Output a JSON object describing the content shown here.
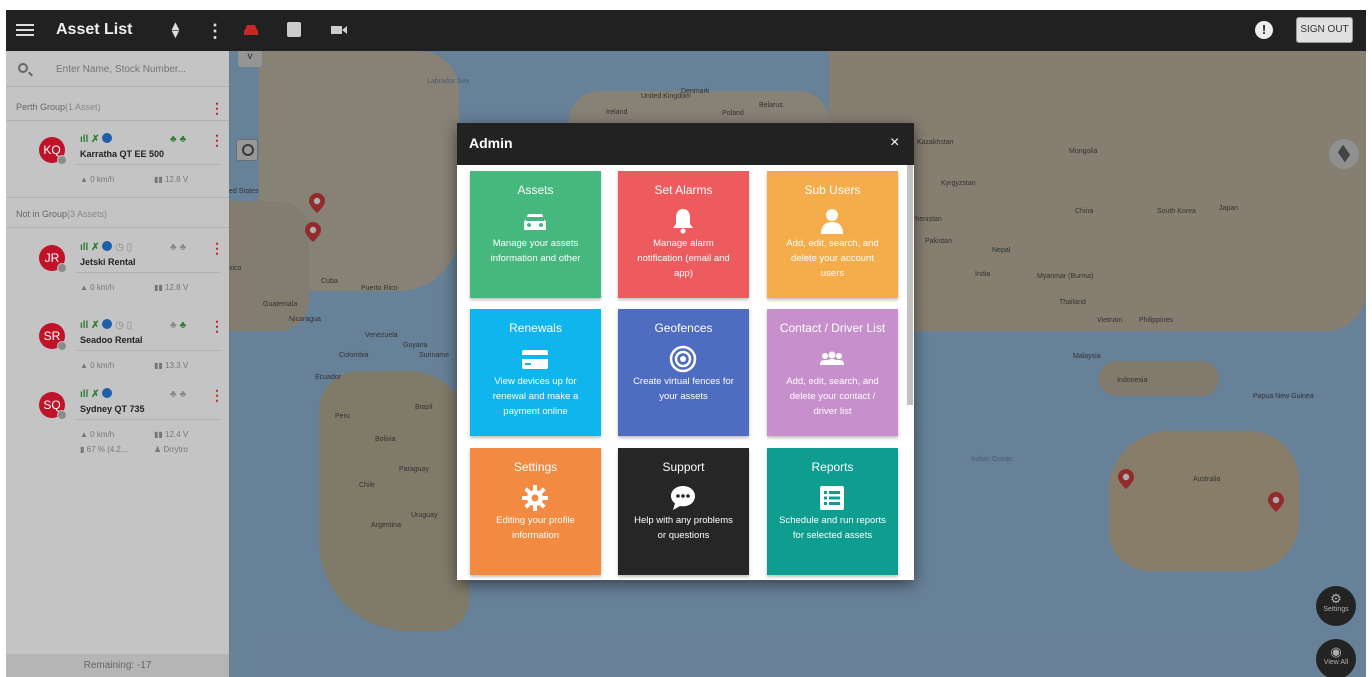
{
  "topbar": {
    "title": "Asset List",
    "sign_out_label": "SIGN OUT",
    "icons": [
      "menu-icon",
      "sort-icon",
      "more-vert-icon",
      "car-icon",
      "map-icon",
      "video-icon",
      "alert-icon"
    ],
    "alert_glyph": "!"
  },
  "sidebar": {
    "search_placeholder": "Enter Name, Stock Number...",
    "groups": [
      {
        "name": "Perth Group",
        "count": "(1 Asset)"
      },
      {
        "name": "Not in Group",
        "count": "(3 Assets)"
      }
    ],
    "assets": [
      {
        "initials": "KQ",
        "name": "Karratha QT EE 500",
        "speed": "0 km/h",
        "voltage": "12.8 V"
      },
      {
        "initials": "JR",
        "name": "Jetski Rental",
        "speed": "0 km/h",
        "voltage": "12.8 V"
      },
      {
        "initials": "SR",
        "name": "Seadoo Rental",
        "speed": "0 km/h",
        "voltage": "13.3 V"
      },
      {
        "initials": "SQ",
        "name": "Sydney QT 735",
        "speed": "0 km/h",
        "voltage": "12.4 V",
        "battery": "67 % (4.2...",
        "driver": "Drrytro"
      }
    ],
    "remaining": "Remaining: -17"
  },
  "map": {
    "labels": [
      "Labrador Sea",
      "United Kingdom",
      "Denmark",
      "Ireland",
      "Poland",
      "Belarus",
      "Kazakhstan",
      "Mongolia",
      "Kyrgyzstan",
      "China",
      "South Korea",
      "Japan",
      "Pakistan",
      "Nepal",
      "India",
      "Myanmar (Burma)",
      "Thailand",
      "Vietnam",
      "Philippines",
      "Malaysia",
      "Indonesia",
      "Papua New Guinea",
      "Australia",
      "Cuba",
      "Puerto Rico",
      "Guatemala",
      "Nicaragua",
      "Venezuela",
      "Guyana",
      "Suriname",
      "Colombia",
      "Ecuador",
      "Peru",
      "Brazil",
      "Bolivia",
      "Paraguay",
      "Chile",
      "Uruguay",
      "Argentina",
      "Indian Ocean",
      "ed States",
      "xico",
      "rhenistan"
    ],
    "controls": {
      "settings_label": "Settings",
      "view_all_label": "View All",
      "zoom_glyph": "v"
    }
  },
  "modal": {
    "title": "Admin",
    "close_glyph": "×",
    "tiles": [
      {
        "title": "Assets",
        "desc": "Manage your assets information and other",
        "color": "#46b77d",
        "icon": "car-icon"
      },
      {
        "title": "Set Alarms",
        "desc": "Manage alarm notification (email and app)",
        "color": "#ee5b5f",
        "icon": "bell-icon"
      },
      {
        "title": "Sub Users",
        "desc": "Add, edit, search, and delete your account users",
        "color": "#f5ac4b",
        "icon": "user-icon"
      },
      {
        "title": "Renewals",
        "desc": "View devices up for renewal and make a payment online",
        "color": "#0fb6ee",
        "icon": "credit-card-icon"
      },
      {
        "title": "Geofences",
        "desc": "Create virtual fences for your assets",
        "color": "#4e6cc0",
        "icon": "geofence-icon"
      },
      {
        "title": "Contact / Driver List",
        "desc": "Add, edit, search, and delete your contact / driver list",
        "color": "#c88fcd",
        "icon": "people-icon"
      },
      {
        "title": "Settings",
        "desc": "Editing your profile information",
        "color": "#f28a42",
        "icon": "gear-icon"
      },
      {
        "title": "Support",
        "desc": "Help with any problems or questions",
        "color": "#262626",
        "icon": "chat-icon"
      },
      {
        "title": "Reports",
        "desc": "Schedule and run reports for selected assets",
        "color": "#0e9d8e",
        "icon": "list-icon"
      }
    ]
  }
}
